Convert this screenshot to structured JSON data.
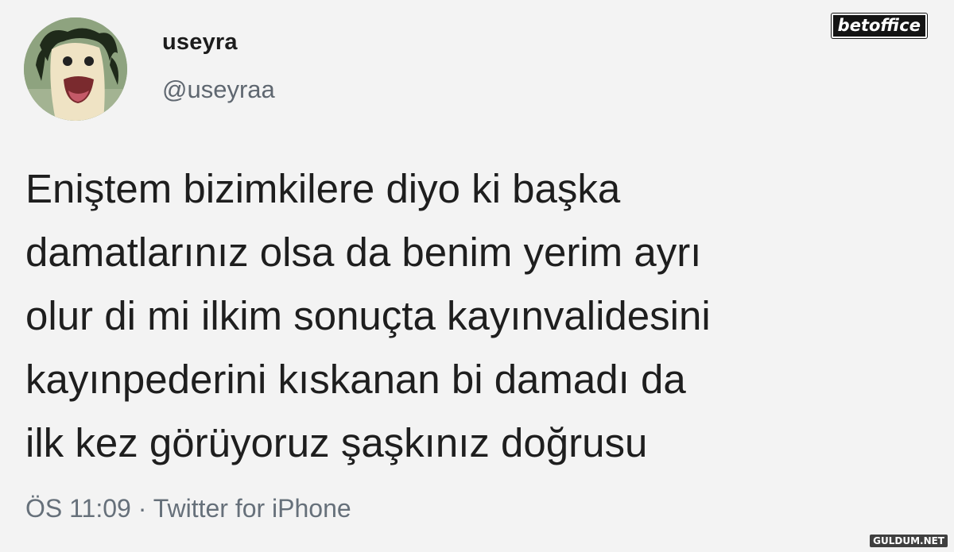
{
  "author": {
    "name": "useyra",
    "handle": "@useyraa",
    "avatar": "sock-puppet-avatar"
  },
  "tweet": {
    "lines": [
      "Eniştem bizimkilere diyo ki başka",
      "damatlarınız olsa da benim yerim ayrı",
      "olur di mi ilkim sonuçta kayınvalidesini",
      "kayınpederini kıskanan bi damadı da",
      "ilk kez görüyoruz şaşkınız doğrusu"
    ]
  },
  "meta": {
    "time": "ÖS 11:09",
    "separator": " · ",
    "source": "Twitter for iPhone"
  },
  "watermarks": {
    "top_right": "betoffice",
    "bottom_right": "GULDUM.NET"
  },
  "colors": {
    "background": "#f3f3f3",
    "text": "#1e1e1e",
    "secondary_text": "#5f6770"
  }
}
